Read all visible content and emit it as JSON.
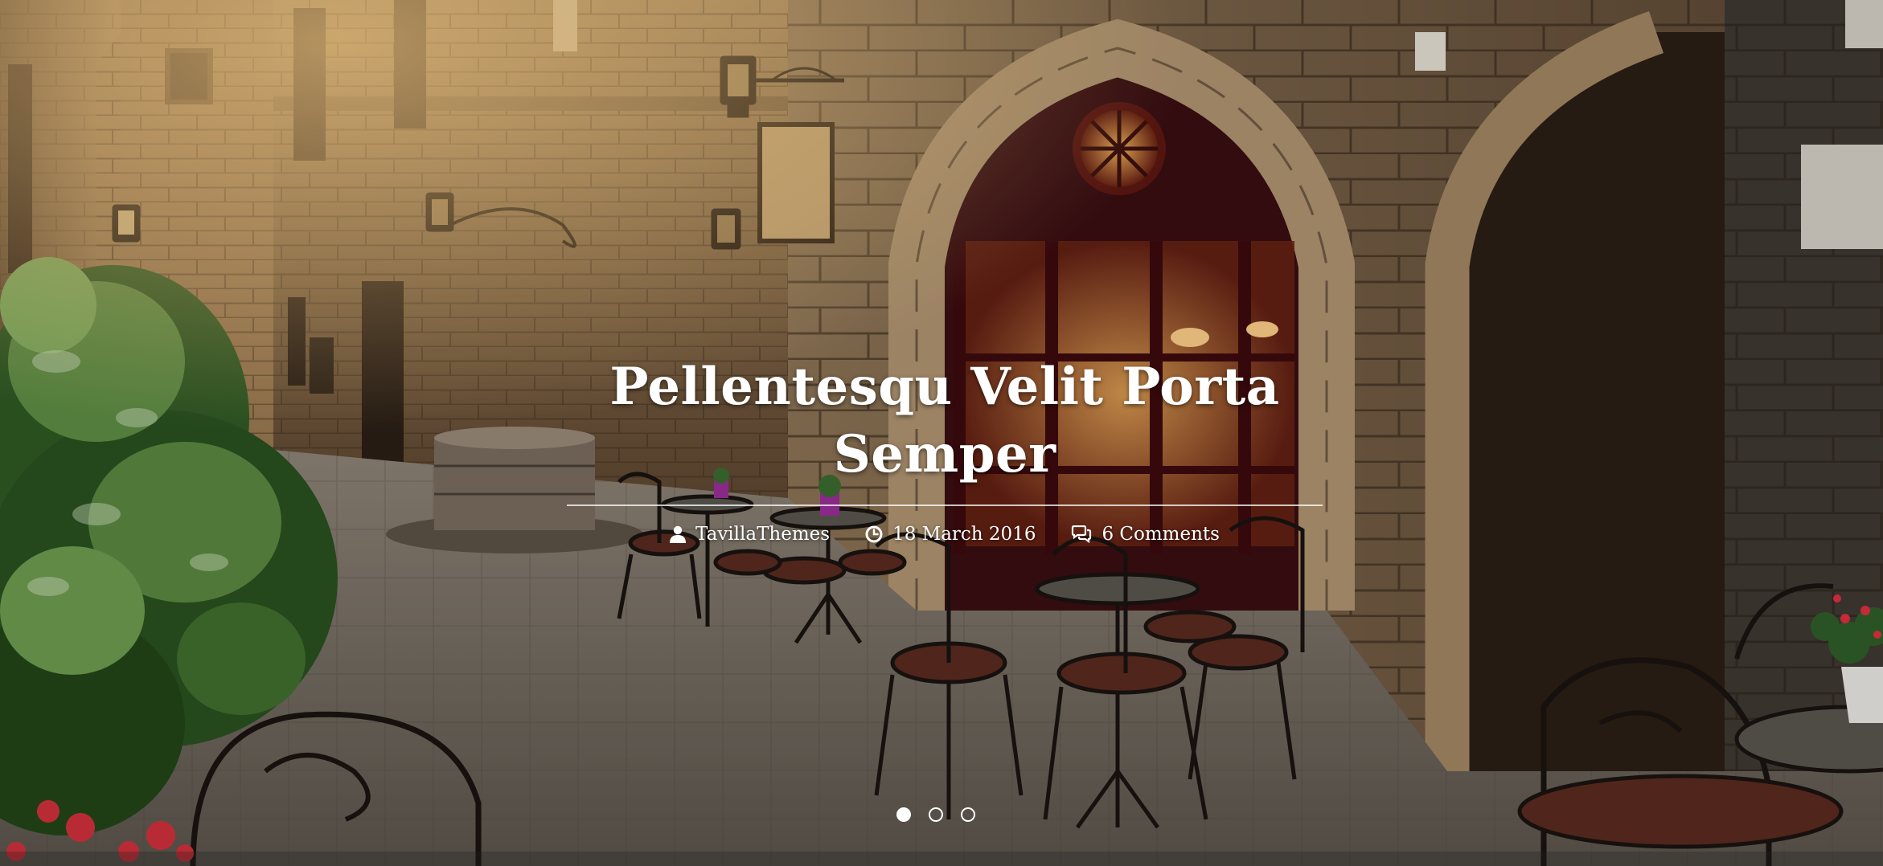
{
  "slide": {
    "title": "Pellentesqu Velit Porta Semper",
    "meta": {
      "author": "TavillaThemes",
      "date": "18 March 2016",
      "comments": "6 Comments"
    },
    "image_description_icon": "photo-background"
  },
  "pagination": {
    "count": 3,
    "active_index": 0
  },
  "colors": {
    "text": "#ffffff",
    "stone": "#8a6f4c",
    "shade": "#2a1b10",
    "doorway": "#4a0f12"
  }
}
